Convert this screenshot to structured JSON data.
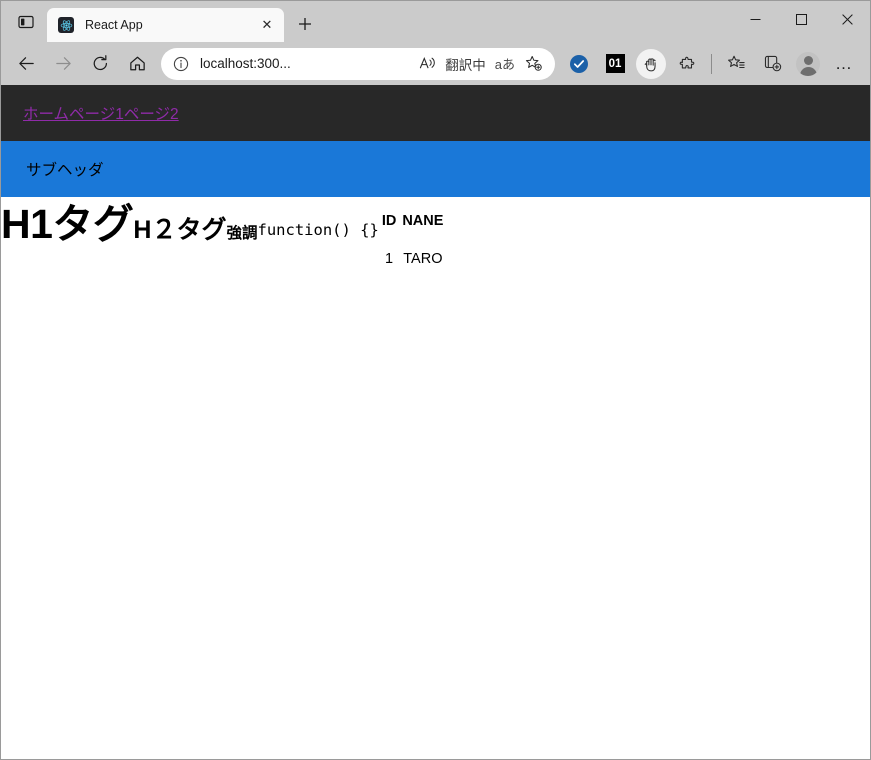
{
  "browser": {
    "window_controls": {
      "minimize_label": "─",
      "maximize_label": "□",
      "close_label": "✕"
    },
    "tab_sidebar_icon": "sidebar-icon",
    "tabs": [
      {
        "title": "React App",
        "favicon": "react-logo-icon",
        "close_label": "✕",
        "active": true
      }
    ],
    "new_tab_label": "+",
    "nav": {
      "back_label": "←",
      "forward_label": "→",
      "refresh_label": "↻",
      "home_label": "home-icon"
    },
    "omnibox": {
      "info_icon": "info-circle-icon",
      "url": "localhost:300...",
      "read_aloud_icon": "read-aloud-icon",
      "translate_status": "翻訳中",
      "translate_icon_label": "aあ",
      "favorite_icon": "add-favorite-star-icon"
    },
    "toolbar_icons": [
      {
        "name": "shield-check-icon",
        "label": "✓"
      },
      {
        "name": "counter-badge-icon",
        "label": "01"
      },
      {
        "name": "hand-cursor-icon",
        "label": "hand"
      },
      {
        "name": "extensions-puzzle-icon",
        "label": "puzzle"
      },
      {
        "name": "favorites-star-list-icon",
        "label": "favorites"
      },
      {
        "name": "collections-icon",
        "label": "collections"
      },
      {
        "name": "profile-avatar-icon",
        "label": "profile"
      },
      {
        "name": "settings-more-icon",
        "label": "…"
      }
    ]
  },
  "page": {
    "header": {
      "links": [
        {
          "label": "ホーム"
        },
        {
          "label": "ページ1"
        },
        {
          "label": "ページ2"
        }
      ]
    },
    "subheader": {
      "text": "サブヘッダ"
    },
    "main": {
      "h1": "H1タグ",
      "h2": "H２タグ",
      "strong": "強調",
      "code": "function() {}",
      "table": {
        "headers": [
          "ID",
          "NANE"
        ],
        "rows": [
          [
            "1",
            "TARO"
          ]
        ]
      }
    }
  },
  "colors": {
    "page_header_bg": "#282828",
    "page_subheader_bg": "#1a78d8",
    "link": "#8f2ba8",
    "chrome_bg": "#cbcbcb",
    "tab_active_bg": "#f9f9f9"
  }
}
